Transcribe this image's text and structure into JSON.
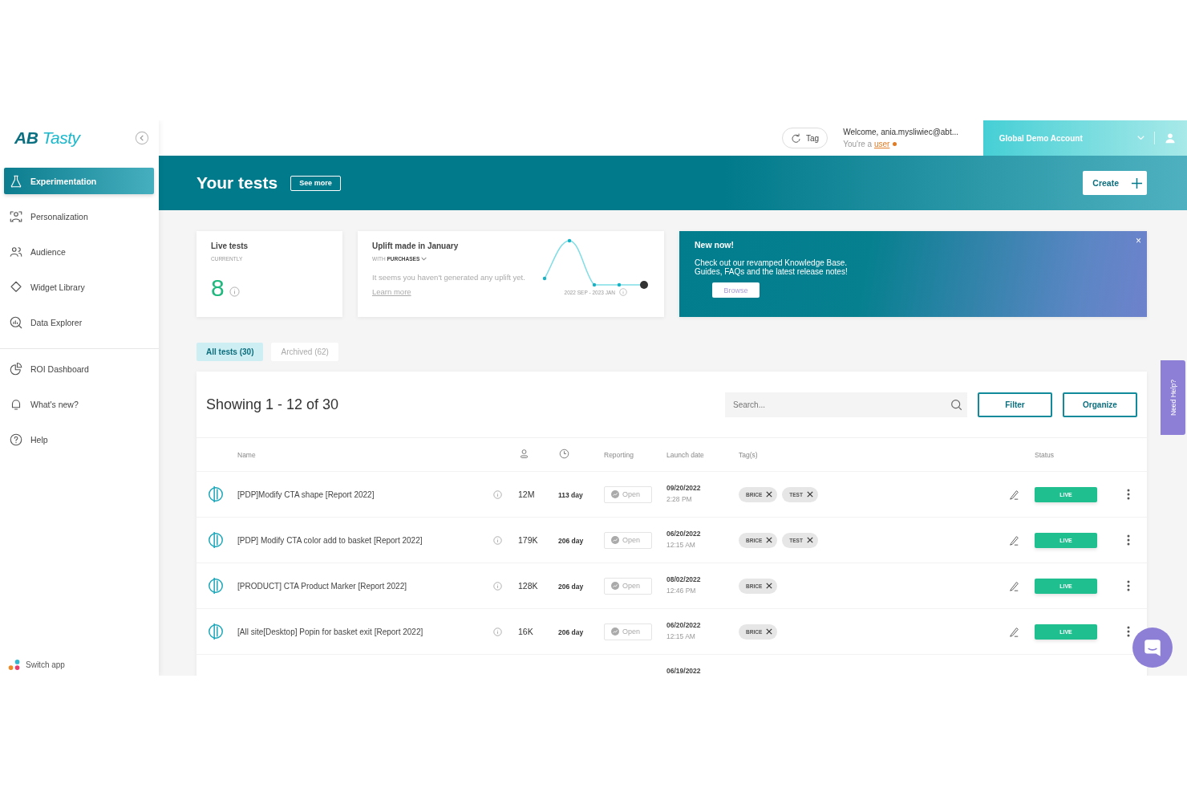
{
  "sidebar": {
    "logo": {
      "first": "AB",
      "second": "Tasty"
    },
    "main_items": [
      {
        "label": "Experimentation",
        "selected": true
      },
      {
        "label": "Personalization",
        "selected": false
      },
      {
        "label": "Audience",
        "selected": false
      },
      {
        "label": "Widget Library",
        "selected": false
      },
      {
        "label": "Data Explorer",
        "selected": false
      }
    ],
    "secondary_items": [
      {
        "label": "ROI Dashboard",
        "selected": false
      },
      {
        "label": "What's new?",
        "selected": false
      },
      {
        "label": "Help",
        "selected": false
      }
    ],
    "switch_app": "Switch app"
  },
  "topbar": {
    "tag_button": "Tag",
    "welcome": "Welcome, ania.mysliwiec@abt...",
    "role_prefix": "You're a",
    "role_link": "user",
    "account": "Global Demo Account"
  },
  "banner": {
    "title": "Your tests",
    "see_more": "See more",
    "create": "Create"
  },
  "live_card": {
    "title": "Live tests",
    "subtitle": "CURRENTLY",
    "value": "8"
  },
  "uplift_card": {
    "title": "Uplift made in January",
    "with_label": "WITH",
    "metric": "PURCHASES",
    "message": "It seems you haven't generated any uplift yet.",
    "link": "Learn more",
    "range": "2022 SEP - 2023 JAN"
  },
  "news_card": {
    "title": "New now!",
    "line_1": "Check out our revamped Knowledge Base.",
    "line_2": "Guides, FAQs and the latest release notes!",
    "button": "Browse",
    "close": "×"
  },
  "tabs": [
    {
      "label": "All tests (30)",
      "selected": true
    },
    {
      "label": "Archived (62)",
      "selected": false
    }
  ],
  "table": {
    "heading": "Showing 1 - 12 of 30",
    "search": {
      "placeholder": "Search..."
    },
    "filter": "Filter",
    "organize": "Organize",
    "columns": {
      "name": "Name",
      "reporting": "Reporting",
      "launch_date": "Launch date",
      "tags": "Tag(s)",
      "status": "Status"
    },
    "rows": [
      {
        "name": "[PDP]Modify CTA shape [Report 2022]",
        "traffic": "12M",
        "duration": "113 day",
        "reporting": "Open",
        "date": "09/20/2022",
        "time": "2:28 PM",
        "tags": [
          "BRICE",
          "TEST"
        ],
        "status": "LIVE"
      },
      {
        "name": "[PDP] Modify CTA color add to basket [Report 2022]",
        "traffic": "179K",
        "duration": "206 day",
        "reporting": "Open",
        "date": "06/20/2022",
        "time": "12:15 AM",
        "tags": [
          "BRICE",
          "TEST"
        ],
        "status": "LIVE"
      },
      {
        "name": "[PRODUCT] CTA Product Marker [Report 2022]",
        "traffic": "128K",
        "duration": "206 day",
        "reporting": "Open",
        "date": "08/02/2022",
        "time": "12:46 PM",
        "tags": [
          "BRICE"
        ],
        "status": "LIVE"
      },
      {
        "name": "[All site[Desktop] Popin for basket exit [Report 2022]",
        "traffic": "16K",
        "duration": "206 day",
        "reporting": "Open",
        "date": "06/20/2022",
        "time": "12:15 AM",
        "tags": [
          "BRICE"
        ],
        "status": "LIVE"
      },
      {
        "date": "06/19/2022"
      }
    ]
  },
  "need_help": "Need Help?"
}
